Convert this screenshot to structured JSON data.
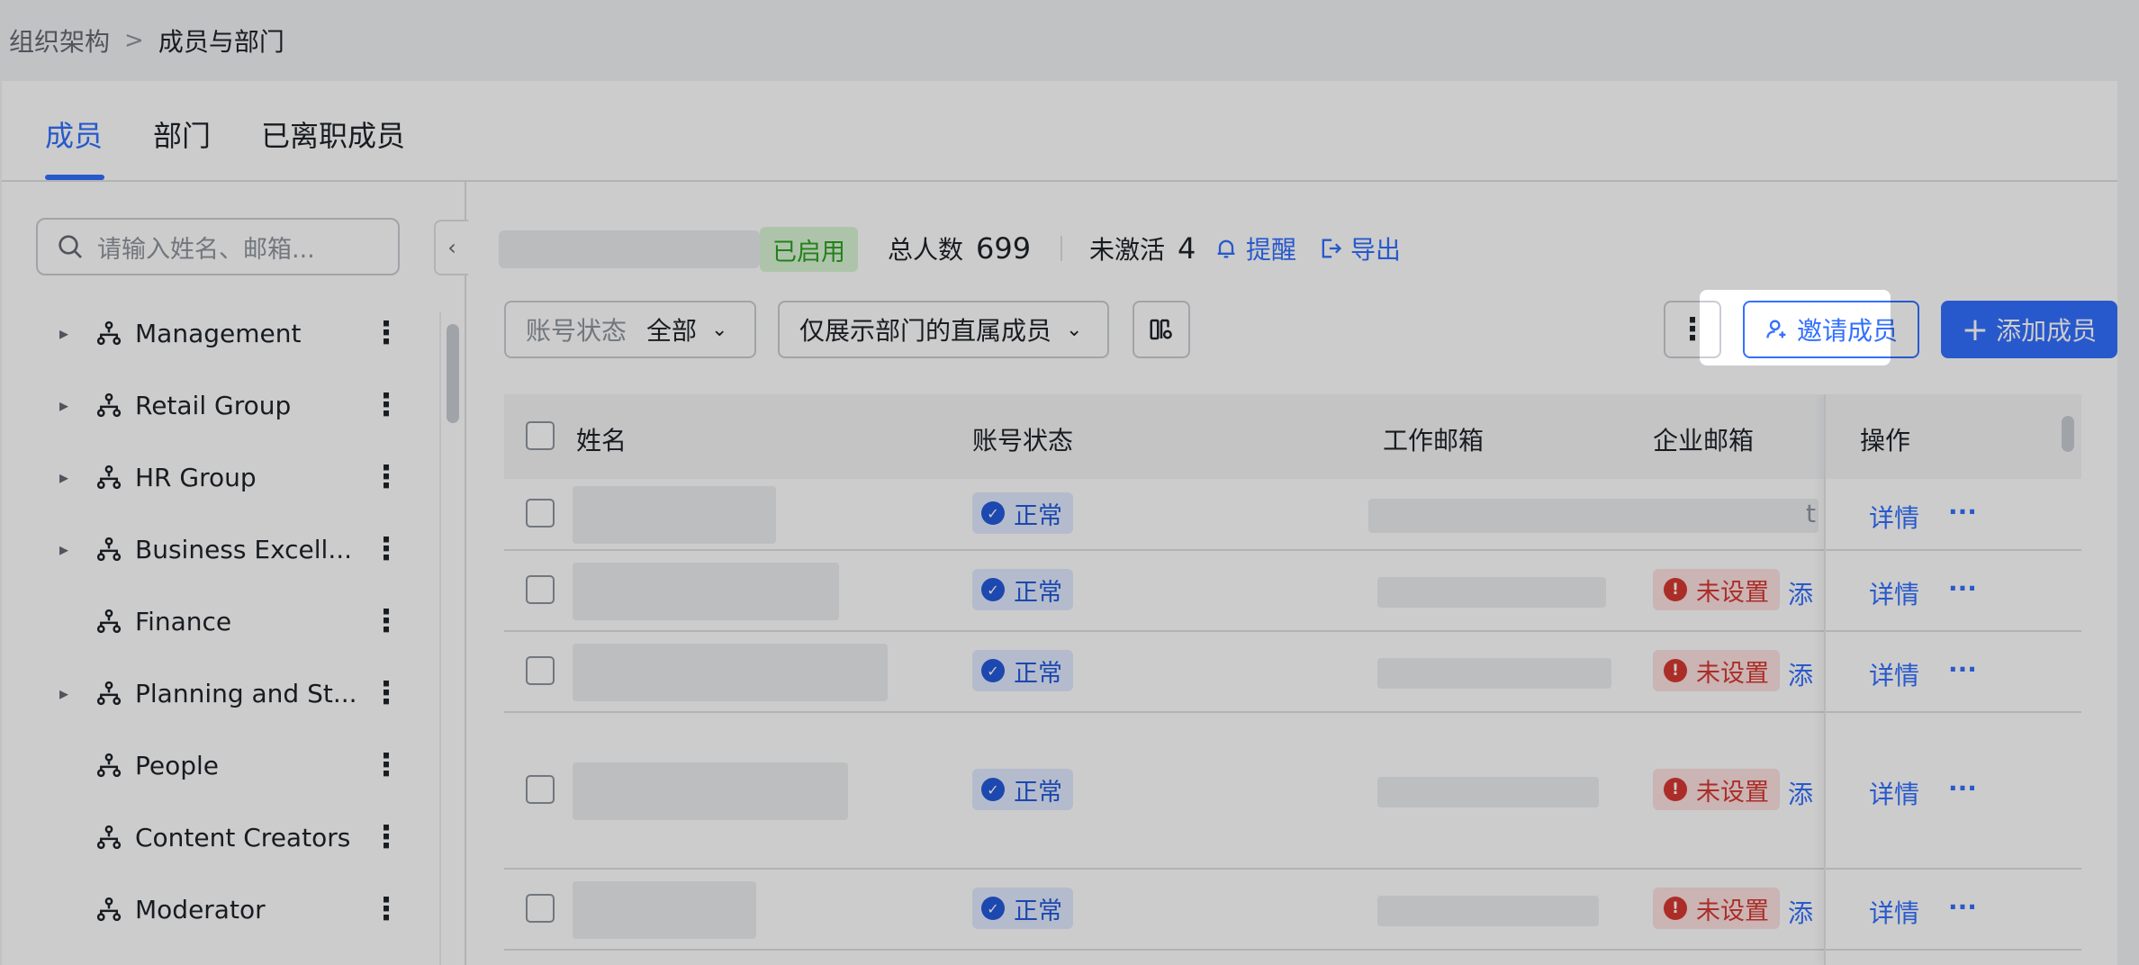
{
  "breadcrumb": {
    "parent": "组织架构",
    "separator": ">",
    "current": "成员与部门"
  },
  "tabs": [
    {
      "label": "成员",
      "active": true
    },
    {
      "label": "部门",
      "active": false
    },
    {
      "label": "已离职成员",
      "active": false
    }
  ],
  "sidebar": {
    "search_placeholder": "请输入姓名、邮箱...",
    "collapse_glyph": "‹",
    "items": [
      {
        "label": "Management",
        "expandable": true
      },
      {
        "label": "Retail Group",
        "expandable": true
      },
      {
        "label": "HR Group",
        "expandable": true
      },
      {
        "label": "Business Excell...",
        "expandable": true
      },
      {
        "label": "Finance",
        "expandable": false
      },
      {
        "label": "Planning and St...",
        "expandable": true
      },
      {
        "label": "People",
        "expandable": false
      },
      {
        "label": "Content Creators",
        "expandable": false
      },
      {
        "label": "Moderator",
        "expandable": false
      }
    ]
  },
  "stats": {
    "status_badge": "已启用",
    "total_label": "总人数",
    "total_value": "699",
    "inactive_label": "未激活",
    "inactive_value": "4",
    "remind_label": "提醒",
    "export_label": "导出"
  },
  "filters": {
    "account_status_label": "账号状态",
    "account_status_value": "全部",
    "direct_members_label": "仅展示部门的直属成员"
  },
  "actions": {
    "invite_label": "邀请成员",
    "add_label": "添加成员",
    "add_glyph": "+"
  },
  "table": {
    "columns": {
      "name": "姓名",
      "account_status": "账号状态",
      "work_email": "工作邮箱",
      "corp_email": "企业邮箱",
      "ops": "操作"
    },
    "rows": [
      {
        "status": "正常",
        "corp_email_status": "",
        "add_link": "",
        "partial_char": "t",
        "detail": "详情",
        "more": "···"
      },
      {
        "status": "正常",
        "corp_email_status": "未设置",
        "add_link": "添",
        "partial_char": "",
        "detail": "详情",
        "more": "···"
      },
      {
        "status": "正常",
        "corp_email_status": "未设置",
        "add_link": "添",
        "partial_char": "",
        "detail": "详情",
        "more": "···"
      },
      {
        "status": "正常",
        "corp_email_status": "未设置",
        "add_link": "添",
        "partial_char": "",
        "detail": "详情",
        "more": "···"
      },
      {
        "status": "正常",
        "corp_email_status": "未设置",
        "add_link": "添",
        "partial_char": "",
        "detail": "详情",
        "more": "···"
      }
    ]
  },
  "colors": {
    "accent": "#3370ff",
    "success": "#2ea121",
    "danger": "#d83931",
    "overlay": "#000000"
  }
}
